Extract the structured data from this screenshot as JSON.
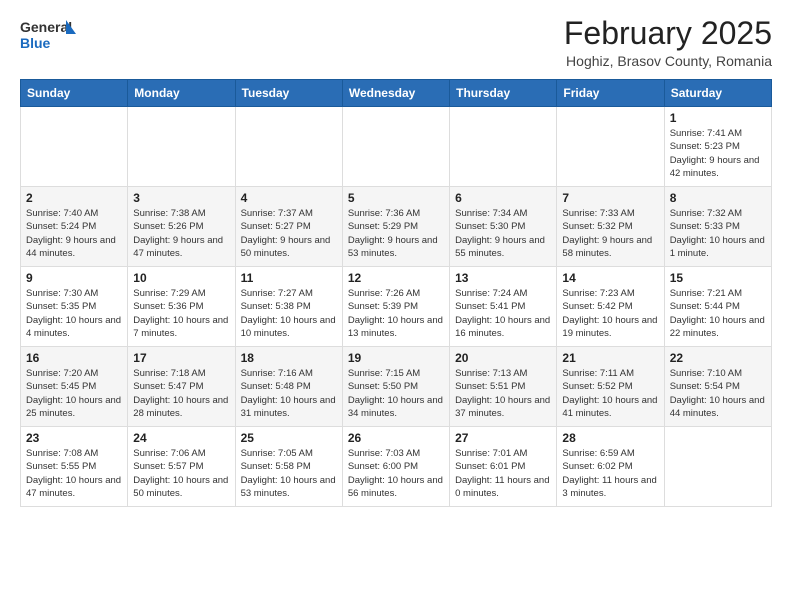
{
  "header": {
    "logo_general": "General",
    "logo_blue": "Blue",
    "main_title": "February 2025",
    "subtitle": "Hoghiz, Brasov County, Romania"
  },
  "calendar": {
    "days_of_week": [
      "Sunday",
      "Monday",
      "Tuesday",
      "Wednesday",
      "Thursday",
      "Friday",
      "Saturday"
    ],
    "weeks": [
      [
        {
          "day": "",
          "info": ""
        },
        {
          "day": "",
          "info": ""
        },
        {
          "day": "",
          "info": ""
        },
        {
          "day": "",
          "info": ""
        },
        {
          "day": "",
          "info": ""
        },
        {
          "day": "",
          "info": ""
        },
        {
          "day": "1",
          "info": "Sunrise: 7:41 AM\nSunset: 5:23 PM\nDaylight: 9 hours\nand 42 minutes."
        }
      ],
      [
        {
          "day": "2",
          "info": "Sunrise: 7:40 AM\nSunset: 5:24 PM\nDaylight: 9 hours\nand 44 minutes."
        },
        {
          "day": "3",
          "info": "Sunrise: 7:38 AM\nSunset: 5:26 PM\nDaylight: 9 hours\nand 47 minutes."
        },
        {
          "day": "4",
          "info": "Sunrise: 7:37 AM\nSunset: 5:27 PM\nDaylight: 9 hours\nand 50 minutes."
        },
        {
          "day": "5",
          "info": "Sunrise: 7:36 AM\nSunset: 5:29 PM\nDaylight: 9 hours\nand 53 minutes."
        },
        {
          "day": "6",
          "info": "Sunrise: 7:34 AM\nSunset: 5:30 PM\nDaylight: 9 hours\nand 55 minutes."
        },
        {
          "day": "7",
          "info": "Sunrise: 7:33 AM\nSunset: 5:32 PM\nDaylight: 9 hours\nand 58 minutes."
        },
        {
          "day": "8",
          "info": "Sunrise: 7:32 AM\nSunset: 5:33 PM\nDaylight: 10 hours\nand 1 minute."
        }
      ],
      [
        {
          "day": "9",
          "info": "Sunrise: 7:30 AM\nSunset: 5:35 PM\nDaylight: 10 hours\nand 4 minutes."
        },
        {
          "day": "10",
          "info": "Sunrise: 7:29 AM\nSunset: 5:36 PM\nDaylight: 10 hours\nand 7 minutes."
        },
        {
          "day": "11",
          "info": "Sunrise: 7:27 AM\nSunset: 5:38 PM\nDaylight: 10 hours\nand 10 minutes."
        },
        {
          "day": "12",
          "info": "Sunrise: 7:26 AM\nSunset: 5:39 PM\nDaylight: 10 hours\nand 13 minutes."
        },
        {
          "day": "13",
          "info": "Sunrise: 7:24 AM\nSunset: 5:41 PM\nDaylight: 10 hours\nand 16 minutes."
        },
        {
          "day": "14",
          "info": "Sunrise: 7:23 AM\nSunset: 5:42 PM\nDaylight: 10 hours\nand 19 minutes."
        },
        {
          "day": "15",
          "info": "Sunrise: 7:21 AM\nSunset: 5:44 PM\nDaylight: 10 hours\nand 22 minutes."
        }
      ],
      [
        {
          "day": "16",
          "info": "Sunrise: 7:20 AM\nSunset: 5:45 PM\nDaylight: 10 hours\nand 25 minutes."
        },
        {
          "day": "17",
          "info": "Sunrise: 7:18 AM\nSunset: 5:47 PM\nDaylight: 10 hours\nand 28 minutes."
        },
        {
          "day": "18",
          "info": "Sunrise: 7:16 AM\nSunset: 5:48 PM\nDaylight: 10 hours\nand 31 minutes."
        },
        {
          "day": "19",
          "info": "Sunrise: 7:15 AM\nSunset: 5:50 PM\nDaylight: 10 hours\nand 34 minutes."
        },
        {
          "day": "20",
          "info": "Sunrise: 7:13 AM\nSunset: 5:51 PM\nDaylight: 10 hours\nand 37 minutes."
        },
        {
          "day": "21",
          "info": "Sunrise: 7:11 AM\nSunset: 5:52 PM\nDaylight: 10 hours\nand 41 minutes."
        },
        {
          "day": "22",
          "info": "Sunrise: 7:10 AM\nSunset: 5:54 PM\nDaylight: 10 hours\nand 44 minutes."
        }
      ],
      [
        {
          "day": "23",
          "info": "Sunrise: 7:08 AM\nSunset: 5:55 PM\nDaylight: 10 hours\nand 47 minutes."
        },
        {
          "day": "24",
          "info": "Sunrise: 7:06 AM\nSunset: 5:57 PM\nDaylight: 10 hours\nand 50 minutes."
        },
        {
          "day": "25",
          "info": "Sunrise: 7:05 AM\nSunset: 5:58 PM\nDaylight: 10 hours\nand 53 minutes."
        },
        {
          "day": "26",
          "info": "Sunrise: 7:03 AM\nSunset: 6:00 PM\nDaylight: 10 hours\nand 56 minutes."
        },
        {
          "day": "27",
          "info": "Sunrise: 7:01 AM\nSunset: 6:01 PM\nDaylight: 11 hours\nand 0 minutes."
        },
        {
          "day": "28",
          "info": "Sunrise: 6:59 AM\nSunset: 6:02 PM\nDaylight: 11 hours\nand 3 minutes."
        },
        {
          "day": "",
          "info": ""
        }
      ]
    ]
  }
}
